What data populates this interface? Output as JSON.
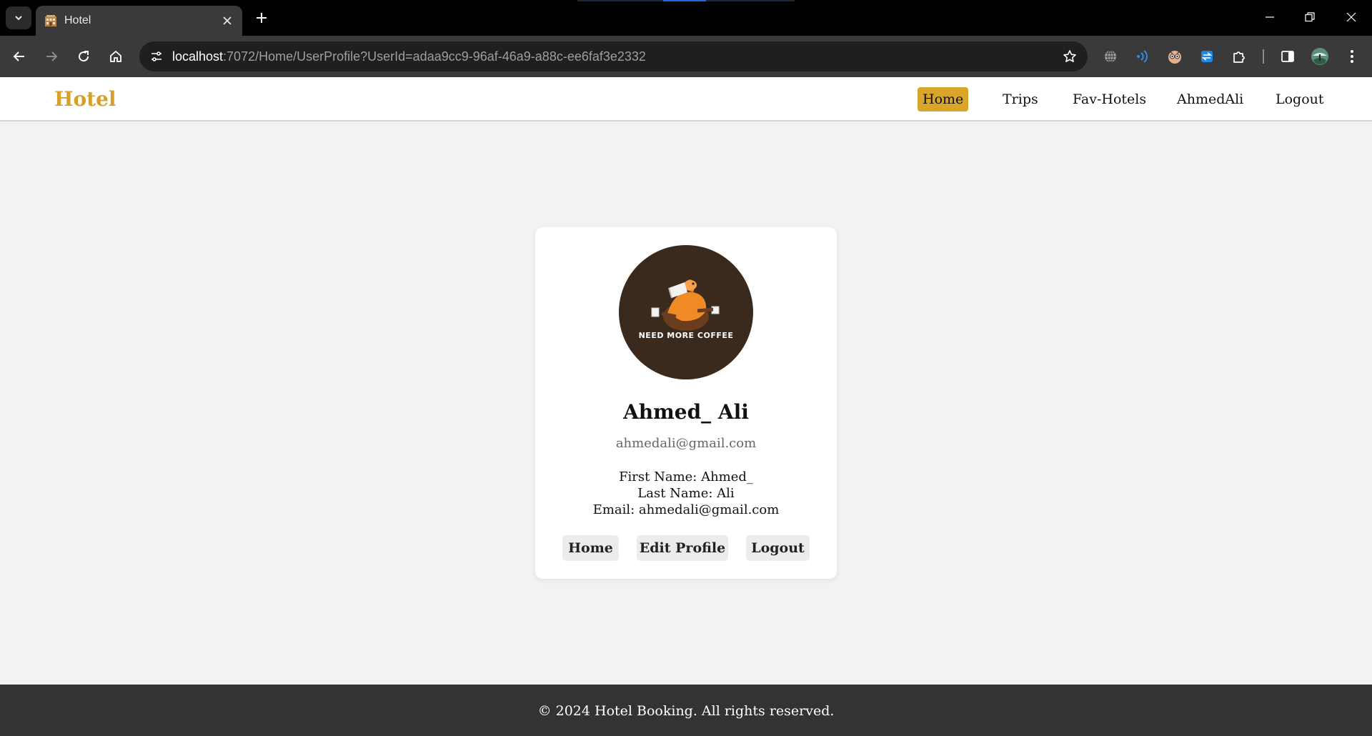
{
  "browser": {
    "tab_title": "Hotel",
    "url_host": "localhost",
    "url_path": ":7072/Home/UserProfile?UserId=adaa9cc9-96af-46a9-a88c-ee6faf3e2332"
  },
  "navbar": {
    "brand": "Hotel",
    "links": [
      "Home",
      "Trips",
      "Fav-Hotels",
      "AhmedAli",
      "Logout"
    ],
    "active_link": "Home"
  },
  "profile": {
    "avatar_caption": "NEED  MORE  COFFEE",
    "full_name": "Ahmed_ Ali",
    "email": "ahmedali@gmail.com",
    "first_name_line": "First Name: Ahmed_",
    "last_name_line": "Last Name: Ali",
    "email_line": "Email: ahmedali@gmail.com",
    "buttons": [
      "Home",
      "Edit Profile",
      "Logout"
    ]
  },
  "footer": {
    "text": "© 2024 Hotel Booking. All rights reserved."
  },
  "colors": {
    "brand": "#d6a12a",
    "active_nav": "#d9a52a",
    "page_bg": "#f2f2f2",
    "footer_bg": "#333333",
    "avatar_bg": "#3a2a1e"
  }
}
